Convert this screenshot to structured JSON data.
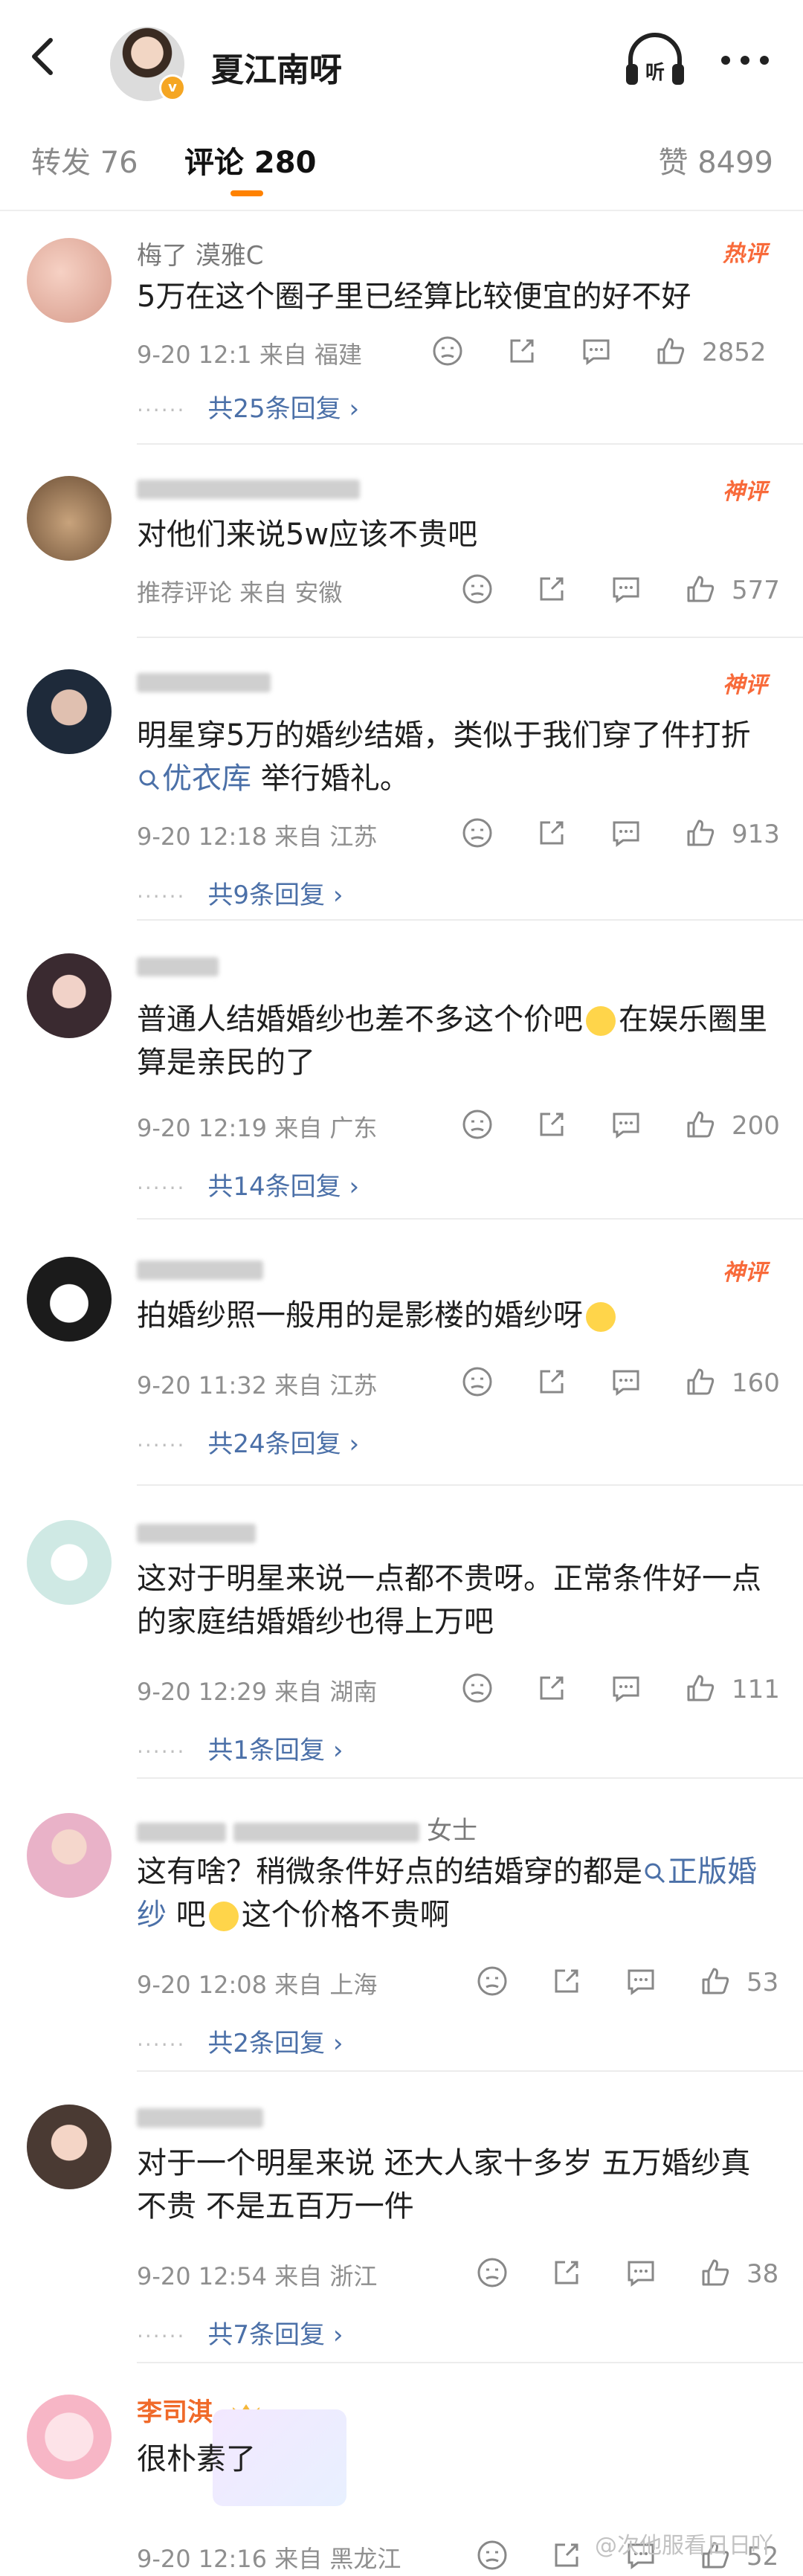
{
  "header": {
    "author": "夏江南呀",
    "listen_label": "听"
  },
  "tabs": {
    "repost": "转发 76",
    "comment": "评论 280",
    "like": "赞 8499"
  },
  "colors": {
    "accent": "#ff8200",
    "link": "#4b70a8",
    "hot": "#f86a3a"
  },
  "comments": [
    {
      "name": "梅了 漠雅C",
      "tag": "热评",
      "text_parts": [
        "5万在这个圈子里已经算比较便宜的好不好"
      ],
      "meta": "9-20 12:1  来自 福建",
      "likes": "2852",
      "replies": "共25条回复 ›"
    },
    {
      "name": "",
      "tag": "神评",
      "text_parts": [
        "对他们来说5w应该不贵吧"
      ],
      "meta": "推荐评论  来自 安徽",
      "likes": "577",
      "replies": ""
    },
    {
      "name": "",
      "tag": "神评",
      "text_parts": [
        "明星穿5万的婚纱结婚，类似于我们穿了件打折",
        "优衣库",
        "举行婚礼。"
      ],
      "meta": "9-20 12:18  来自 江苏",
      "likes": "913",
      "replies": "共9条回复 ›"
    },
    {
      "name": "",
      "tag": "",
      "text_parts": [
        "普通人结婚婚纱也差不多这个价吧",
        "在娱乐圈里算是亲民的了"
      ],
      "meta": "9-20 12:19  来自 广东",
      "likes": "200",
      "replies": "共14条回复 ›"
    },
    {
      "name": "",
      "tag": "神评",
      "text_parts": [
        "拍婚纱照一般用的是影楼的婚纱呀"
      ],
      "meta": "9-20 11:32  来自 江苏",
      "likes": "160",
      "replies": "共24条回复 ›"
    },
    {
      "name": "",
      "tag": "",
      "text_parts": [
        "这对于明星来说一点都不贵呀。正常条件好一点的家庭结婚婚纱也得上万吧"
      ],
      "meta": "9-20 12:29  来自 湖南",
      "likes": "111",
      "replies": "共1条回复 ›"
    },
    {
      "name": "女士",
      "tag": "",
      "text_parts": [
        "这有啥？稍微条件好点的结婚穿的都是",
        "正版婚纱",
        "吧",
        "这个价格不贵啊"
      ],
      "meta": "9-20 12:08  来自 上海",
      "likes": "53",
      "replies": "共2条回复 ›"
    },
    {
      "name": "",
      "tag": "",
      "text_parts": [
        "对于一个明星来说 还大人家十多岁 五万婚纱真不贵 不是五百万一件"
      ],
      "meta": "9-20 12:54  来自 浙江",
      "likes": "38",
      "replies": "共7条回复 ›"
    },
    {
      "name": "李司淇_",
      "tag": "",
      "text_parts": [
        "很朴素了"
      ],
      "meta": "9-20 12:16  来自 黑龙江",
      "likes": "52",
      "replies": ""
    }
  ],
  "watermark": "@次他服看日日吖"
}
